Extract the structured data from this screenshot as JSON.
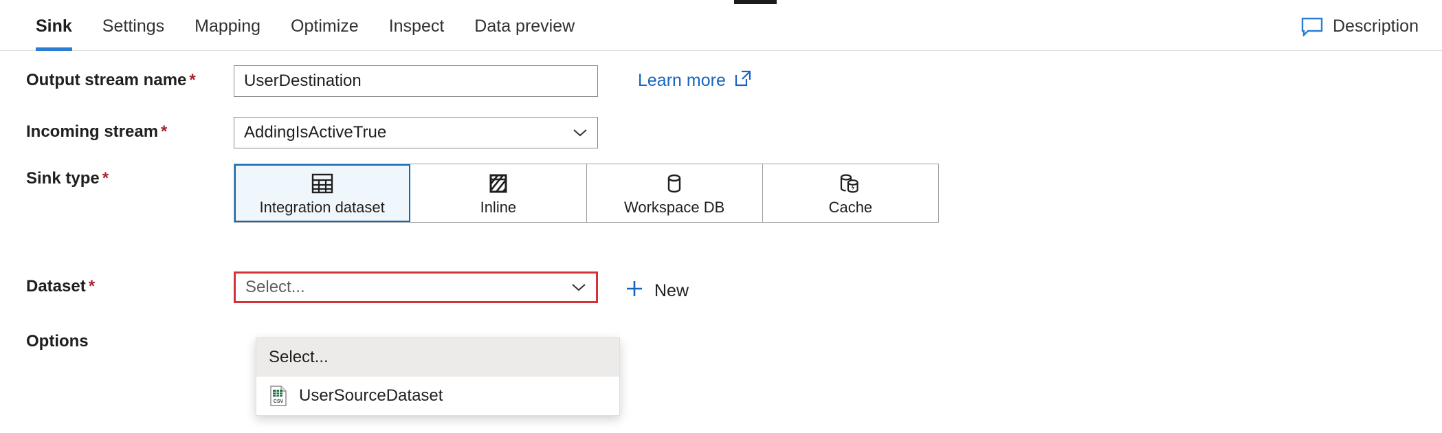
{
  "tabs": [
    {
      "label": "Sink",
      "active": true
    },
    {
      "label": "Settings",
      "active": false
    },
    {
      "label": "Mapping",
      "active": false
    },
    {
      "label": "Optimize",
      "active": false
    },
    {
      "label": "Inspect",
      "active": false
    },
    {
      "label": "Data preview",
      "active": false
    }
  ],
  "header": {
    "description_label": "Description",
    "description_icon": "speech-bubble-icon"
  },
  "colors": {
    "accent": "#2b7cd3",
    "link": "#1664c0",
    "error": "#d13438",
    "required_asterisk": "#a4262c",
    "selected_fill": "#eff6fc",
    "selected_border": "#0f6cbd"
  },
  "form": {
    "output_stream": {
      "label": "Output stream name",
      "required": "*",
      "value": "UserDestination",
      "placeholder": ""
    },
    "learn_more": {
      "label": "Learn more",
      "icon": "external-link-icon"
    },
    "incoming_stream": {
      "label": "Incoming stream",
      "required": "*",
      "value": "AddingIsActiveTrue",
      "chevron": "chevron-down-icon"
    },
    "sink_type": {
      "label": "Sink type",
      "required": "*",
      "options": [
        {
          "label": "Integration dataset",
          "icon": "table-grid-icon",
          "selected": true
        },
        {
          "label": "Inline",
          "icon": "hatched-square-icon",
          "selected": false
        },
        {
          "label": "Workspace DB",
          "icon": "database-cylinder-icon",
          "selected": false
        },
        {
          "label": "Cache",
          "icon": "cache-cylinders-bolt-icon",
          "selected": false
        }
      ]
    },
    "dataset": {
      "label": "Dataset",
      "required": "*",
      "value": "Select...",
      "has_error": true,
      "chevron": "chevron-down-icon",
      "new_button": {
        "label": "New",
        "icon": "plus-icon"
      },
      "dropdown_open": true,
      "dropdown_items": [
        {
          "label": "Select...",
          "icon": "",
          "highlighted": true
        },
        {
          "label": "UserSourceDataset",
          "icon": "csv-file-icon",
          "highlighted": false
        }
      ]
    },
    "options": {
      "label": "Options"
    }
  }
}
